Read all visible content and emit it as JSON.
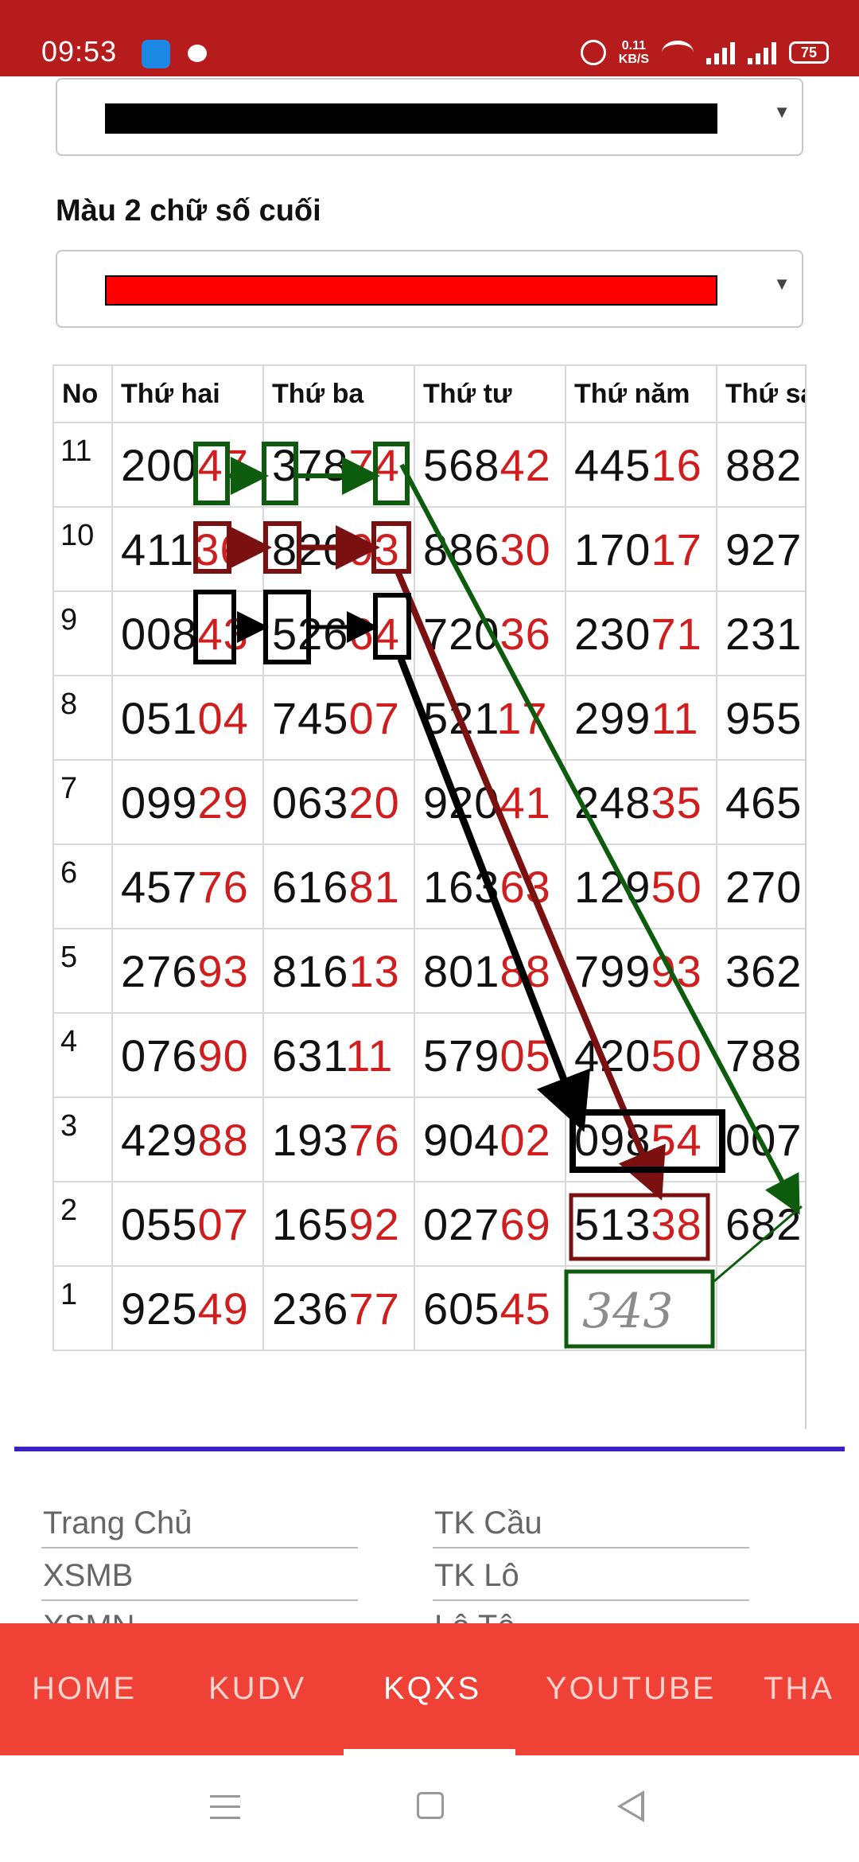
{
  "status_bar": {
    "time": "09:53",
    "speed_value": "0.11",
    "speed_unit": "KB/S",
    "battery": "75",
    "icons": [
      "app-icon",
      "chat-icon",
      "alarm-icon",
      "wifi-icon",
      "signal-icon",
      "battery-icon"
    ]
  },
  "settings": {
    "color_select_1": {
      "swatch_color": "#000000"
    },
    "label_2": "Màu 2 chữ số cuối",
    "color_select_2": {
      "swatch_color": "#ff0000"
    }
  },
  "table": {
    "headers": [
      "No",
      "Thứ hai",
      "Thứ ba",
      "Thứ tư",
      "Thứ năm",
      "Thứ sáu"
    ],
    "rows": [
      {
        "no": "11",
        "cells": [
          [
            "200",
            "47"
          ],
          [
            "378",
            "74"
          ],
          [
            "568",
            "42"
          ],
          [
            "445",
            "16"
          ],
          [
            "882",
            ""
          ]
        ]
      },
      {
        "no": "10",
        "cells": [
          [
            "411",
            "36"
          ],
          [
            "820",
            "93"
          ],
          [
            "886",
            "30"
          ],
          [
            "170",
            "17"
          ],
          [
            "927",
            ""
          ]
        ]
      },
      {
        "no": "9",
        "cells": [
          [
            "008",
            "43"
          ],
          [
            "526",
            "64"
          ],
          [
            "720",
            "36"
          ],
          [
            "230",
            "71"
          ],
          [
            "231",
            ""
          ]
        ]
      },
      {
        "no": "8",
        "cells": [
          [
            "051",
            "04"
          ],
          [
            "745",
            "07"
          ],
          [
            "521",
            "17"
          ],
          [
            "299",
            "11"
          ],
          [
            "955",
            ""
          ]
        ]
      },
      {
        "no": "7",
        "cells": [
          [
            "099",
            "29"
          ],
          [
            "063",
            "20"
          ],
          [
            "920",
            "41"
          ],
          [
            "248",
            "35"
          ],
          [
            "465",
            ""
          ]
        ]
      },
      {
        "no": "6",
        "cells": [
          [
            "457",
            "76"
          ],
          [
            "616",
            "81"
          ],
          [
            "163",
            "63"
          ],
          [
            "129",
            "50"
          ],
          [
            "270",
            ""
          ]
        ]
      },
      {
        "no": "5",
        "cells": [
          [
            "276",
            "93"
          ],
          [
            "816",
            "13"
          ],
          [
            "801",
            "88"
          ],
          [
            "799",
            "93"
          ],
          [
            "362",
            ""
          ]
        ]
      },
      {
        "no": "4",
        "cells": [
          [
            "076",
            "90"
          ],
          [
            "631",
            "11"
          ],
          [
            "579",
            "05"
          ],
          [
            "420",
            "50"
          ],
          [
            "788",
            ""
          ]
        ]
      },
      {
        "no": "3",
        "cells": [
          [
            "429",
            "88"
          ],
          [
            "193",
            "76"
          ],
          [
            "904",
            "02"
          ],
          [
            "098",
            "54"
          ],
          [
            "007",
            ""
          ]
        ]
      },
      {
        "no": "2",
        "cells": [
          [
            "055",
            "07"
          ],
          [
            "165",
            "92"
          ],
          [
            "027",
            "69"
          ],
          [
            "513",
            "38"
          ],
          [
            "682",
            ""
          ]
        ]
      },
      {
        "no": "1",
        "cells": [
          [
            "925",
            "49"
          ],
          [
            "236",
            "77"
          ],
          [
            "605",
            "45"
          ],
          [
            "",
            ""
          ],
          [
            "",
            ""
          ]
        ]
      }
    ]
  },
  "annotation": {
    "handwritten": "343"
  },
  "footer": {
    "links": [
      "Trang Chủ",
      "TK Cầu",
      "XSMB",
      "TK Lô",
      "XSMN",
      "Lô Tô"
    ]
  },
  "tabbar": {
    "tabs": [
      "HOME",
      "KUDV",
      "KQXS",
      "YOUTUBE",
      "THA"
    ],
    "active_index": 2
  },
  "colors": {
    "status_bar": "#b71c1c",
    "tabbar": "#ef4136",
    "separator": "#3b20c2",
    "digits_tail": "#d01e1e",
    "arrow_green": "#0d5c0d",
    "arrow_maroon": "#7a1010",
    "arrow_black": "#000000"
  }
}
